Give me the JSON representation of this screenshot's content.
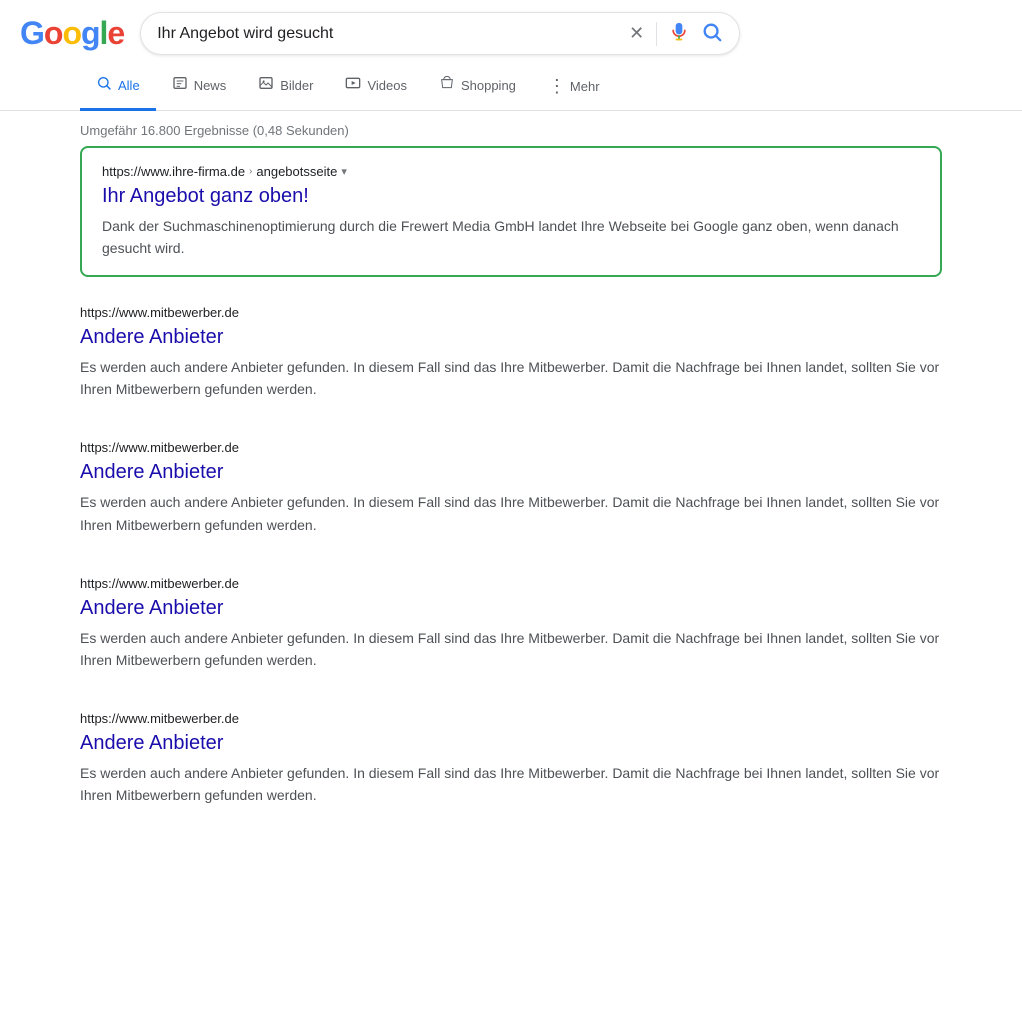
{
  "header": {
    "logo_letters": [
      "G",
      "o",
      "o",
      "g",
      "l",
      "e"
    ],
    "search_query": "Ihr Angebot wird gesucht",
    "clear_label": "×",
    "mic_label": "🎤",
    "search_icon_label": "🔍"
  },
  "tabs": {
    "items": [
      {
        "id": "alle",
        "label": "Alle",
        "icon": "🔍",
        "active": true
      },
      {
        "id": "news",
        "label": "News",
        "icon": "📰",
        "active": false
      },
      {
        "id": "bilder",
        "label": "Bilder",
        "icon": "🖼",
        "active": false
      },
      {
        "id": "videos",
        "label": "Videos",
        "icon": "▶",
        "active": false
      },
      {
        "id": "shopping",
        "label": "Shopping",
        "icon": "🏷",
        "active": false
      }
    ],
    "more_label": "Mehr",
    "more_icon": "⋮"
  },
  "results_info": "Umgefähr 16.800 Ergebnisse (0,48 Sekunden)",
  "featured_result": {
    "url": "https://www.ihre-firma.de",
    "breadcrumb": "angebotsseite",
    "title": "Ihr Angebot ganz oben!",
    "snippet": "Dank der Suchmaschinenoptimierung durch die Frewert Media GmbH landet Ihre Webseite bei Google ganz oben, wenn danach gesucht wird."
  },
  "competitor_results": [
    {
      "url": "https://www.mitbewerber.de",
      "title": "Andere Anbieter",
      "snippet": "Es werden auch andere Anbieter gefunden. In diesem Fall sind das Ihre Mitbewerber. Damit die Nachfrage bei Ihnen landet, sollten Sie vor Ihren Mitbewerbern gefunden werden."
    },
    {
      "url": "https://www.mitbewerber.de",
      "title": "Andere Anbieter",
      "snippet": "Es werden auch andere Anbieter gefunden. In diesem Fall sind das Ihre Mitbewerber. Damit die Nachfrage bei Ihnen landet, sollten Sie vor Ihren Mitbewerbern gefunden werden."
    },
    {
      "url": "https://www.mitbewerber.de",
      "title": "Andere Anbieter",
      "snippet": "Es werden auch andere Anbieter gefunden. In diesem Fall sind das Ihre Mitbewerber. Damit die Nachfrage bei Ihnen landet, sollten Sie vor Ihren Mitbewerbern gefunden werden."
    },
    {
      "url": "https://www.mitbewerber.de",
      "title": "Andere Anbieter",
      "snippet": "Es werden auch andere Anbieter gefunden. In diesem Fall sind das Ihre Mitbewerber. Damit die Nachfrage bei Ihnen landet, sollten Sie vor Ihren Mitbewerbern gefunden werden."
    }
  ]
}
